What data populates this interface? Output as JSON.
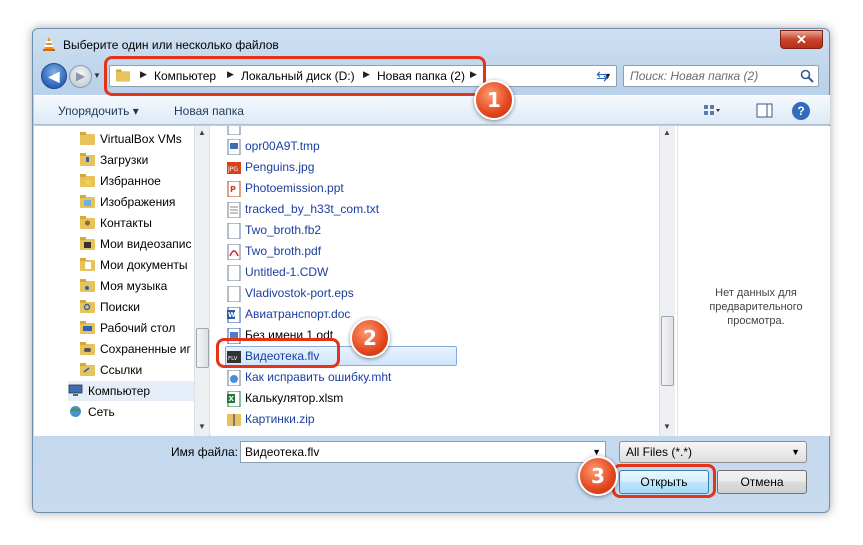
{
  "window": {
    "title": "Выберите один или несколько файлов",
    "close_label": "✕"
  },
  "nav": {
    "breadcrumbs": [
      "Компьютер",
      "Локальный диск (D:)",
      "Новая папка (2)"
    ],
    "search_placeholder": "Поиск: Новая папка (2)"
  },
  "toolbar": {
    "organize_label": "Упорядочить ▾",
    "new_folder_label": "Новая папка",
    "help": "?"
  },
  "tree": {
    "items": [
      {
        "label": "VirtualBox VMs",
        "icon": "folder-icon"
      },
      {
        "label": "Загрузки",
        "icon": "downloads-folder-icon"
      },
      {
        "label": "Избранное",
        "icon": "favorites-folder-icon"
      },
      {
        "label": "Изображения",
        "icon": "pictures-folder-icon"
      },
      {
        "label": "Контакты",
        "icon": "contacts-folder-icon"
      },
      {
        "label": "Мои видеозапис",
        "icon": "videos-folder-icon"
      },
      {
        "label": "Мои документы",
        "icon": "documents-folder-icon"
      },
      {
        "label": "Моя музыка",
        "icon": "music-folder-icon"
      },
      {
        "label": "Поиски",
        "icon": "searches-folder-icon"
      },
      {
        "label": "Рабочий стол",
        "icon": "desktop-folder-icon"
      },
      {
        "label": "Сохраненные иг",
        "icon": "games-folder-icon"
      },
      {
        "label": "Ссылки",
        "icon": "links-folder-icon"
      },
      {
        "label": "Компьютер",
        "icon": "computer-icon"
      },
      {
        "label": "Сеть",
        "icon": "network-icon"
      }
    ]
  },
  "files": {
    "items": [
      {
        "name": "opr00A9T.tmp",
        "icon": "tmp-file-icon"
      },
      {
        "name": "Penguins.jpg",
        "icon": "jpg-file-icon"
      },
      {
        "name": "Photoemission.ppt",
        "icon": "ppt-file-icon"
      },
      {
        "name": "tracked_by_h33t_com.txt",
        "icon": "txt-file-icon"
      },
      {
        "name": "Two_broth.fb2",
        "icon": "fb2-file-icon"
      },
      {
        "name": "Two_broth.pdf",
        "icon": "pdf-file-icon"
      },
      {
        "name": "Untitled-1.CDW",
        "icon": "cdw-file-icon"
      },
      {
        "name": "Vladivostok-port.eps",
        "icon": "eps-file-icon"
      },
      {
        "name": "Авиатранспорт.doc",
        "icon": "doc-file-icon"
      },
      {
        "name": "Без имени 1.odt",
        "icon": "odt-file-icon"
      },
      {
        "name": "Видеотека.flv",
        "icon": "flv-file-icon",
        "selected": true
      },
      {
        "name": "Как исправить ошибку.mht",
        "icon": "mht-file-icon"
      },
      {
        "name": "Калькулятор.xlsm",
        "icon": "xlsm-file-icon"
      },
      {
        "name": "Картинки.zip",
        "icon": "zip-file-icon"
      }
    ]
  },
  "preview": {
    "text": "Нет данных для предварительного просмотра."
  },
  "bottom": {
    "filename_label": "Имя файла:",
    "filename_value": "Видеотека.flv",
    "filter_value": "All Files (*.*)",
    "open_label": "Открыть",
    "cancel_label": "Отмена"
  },
  "markers": [
    "1",
    "2",
    "3"
  ],
  "colors": {
    "accent": "#e3341a",
    "link": "#1b3e9e",
    "selection": "#cfe5fb"
  }
}
